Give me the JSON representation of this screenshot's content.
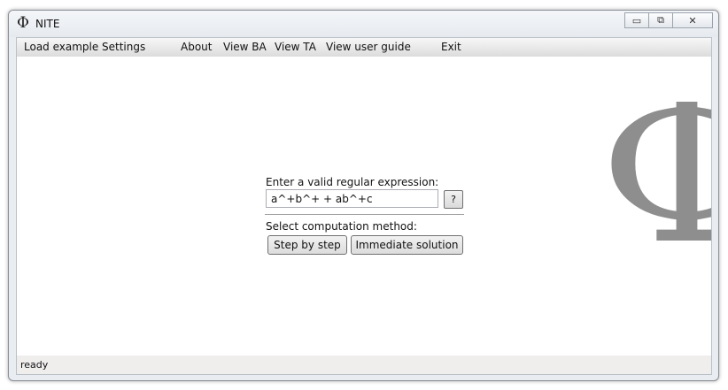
{
  "window": {
    "icon_glyph": "Φ",
    "title": "NITE",
    "controls": {
      "minimize": "▭",
      "restore": "⧉",
      "close": "✕"
    }
  },
  "menu": {
    "items": [
      "Load example",
      "Settings",
      "About",
      "View BA",
      "View TA",
      "View user guide",
      "Exit"
    ]
  },
  "form": {
    "expression_label": "Enter a valid regular expression:",
    "expression_value": "a^+b^+ + ab^+c",
    "help_button": "?",
    "method_label": "Select computation method:",
    "step_button": "Step by step",
    "immediate_button": "Immediate solution"
  },
  "logo": {
    "glyph": "Φ",
    "color": "#8e8e8e"
  },
  "status": {
    "text": "ready"
  }
}
